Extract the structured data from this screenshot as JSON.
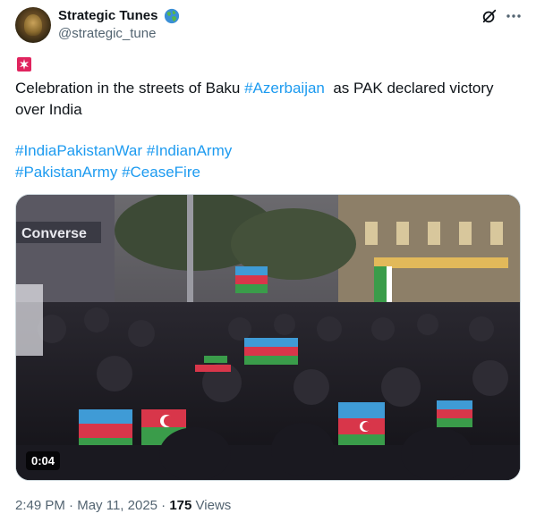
{
  "author": {
    "display_name": "Strategic Tunes",
    "handle": "@strategic_tune"
  },
  "tweet": {
    "text_before": "Celebration in the streets of Baku ",
    "inline_hashtag": "#Azerbaijan",
    "text_after": "  as PAK declared victory over India",
    "hashtags_line1": [
      "#IndiaPakistanWar",
      "#IndianArmy"
    ],
    "hashtags_line2": [
      "#PakistanArmy",
      "#CeaseFire"
    ]
  },
  "media": {
    "storefront_sign": "Converse",
    "duration": "0:04"
  },
  "meta": {
    "time": "2:49 PM",
    "separator": "·",
    "date": "May 11, 2025",
    "views_count": "175",
    "views_label": "Views"
  },
  "icons": {
    "verified_globe": "globe-icon",
    "grok": "grok-icon",
    "more": "more-options-icon",
    "alert": "rotating-light-icon"
  },
  "colors": {
    "hashtag": "#1d9bf0",
    "text": "#0f1419",
    "secondary": "#536471"
  }
}
